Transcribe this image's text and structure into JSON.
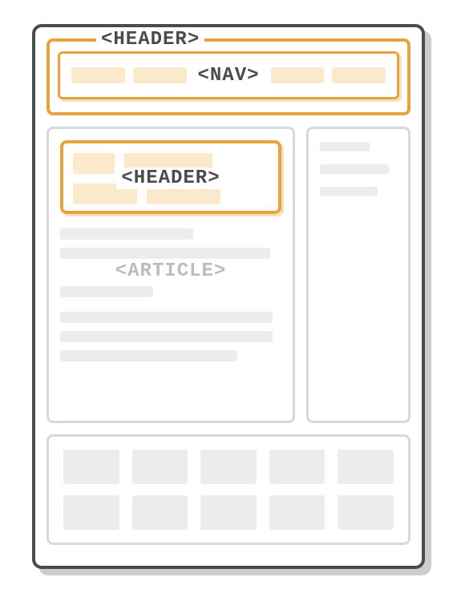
{
  "header": {
    "label": "<HEADER>",
    "nav": {
      "label": "<NAV>"
    }
  },
  "article": {
    "label": "<ARTICLE>",
    "header": {
      "label": "<HEADER>"
    }
  }
}
